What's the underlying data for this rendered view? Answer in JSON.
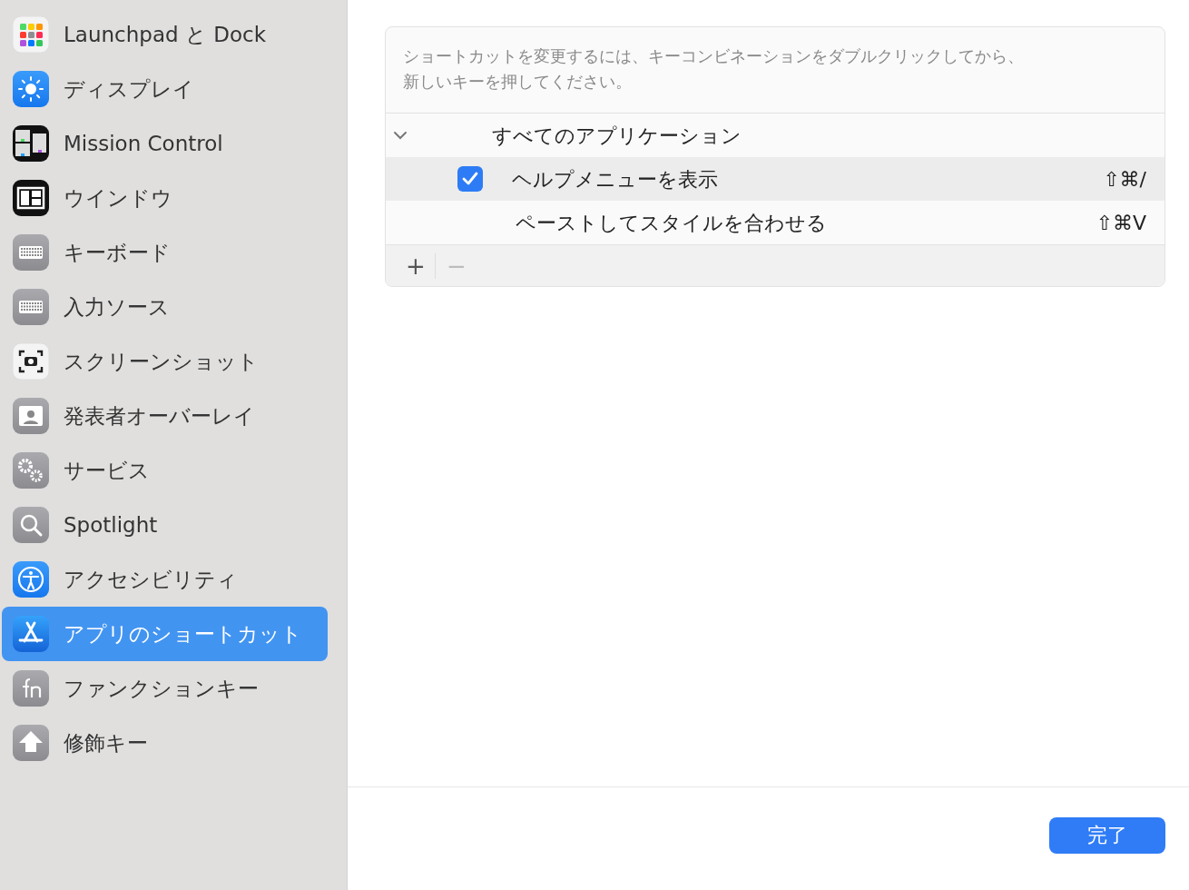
{
  "sidebar": {
    "items": [
      {
        "label": "Launchpad と Dock",
        "selected": false
      },
      {
        "label": "ディスプレイ",
        "selected": false
      },
      {
        "label": "Mission Control",
        "selected": false
      },
      {
        "label": "ウインドウ",
        "selected": false
      },
      {
        "label": "キーボード",
        "selected": false
      },
      {
        "label": "入力ソース",
        "selected": false
      },
      {
        "label": "スクリーンショット",
        "selected": false
      },
      {
        "label": "発表者オーバーレイ",
        "selected": false
      },
      {
        "label": "サービス",
        "selected": false
      },
      {
        "label": "Spotlight",
        "selected": false
      },
      {
        "label": "アクセシビリティ",
        "selected": false
      },
      {
        "label": "アプリのショートカット",
        "selected": true
      },
      {
        "label": "ファンクションキー",
        "selected": false
      },
      {
        "label": "修飾キー",
        "selected": false
      }
    ]
  },
  "shortcuts": {
    "hint_lines": [
      "ショートカットを変更するには、キーコンビネーションをダブルクリックしてから、",
      "新しいキーを押してください。"
    ],
    "group": {
      "label": "すべてのアプリケーション",
      "expanded": true,
      "rows": [
        {
          "kind": "checkbox",
          "checked": true,
          "label": "ヘルプメニューを表示",
          "keys": "⇧⌘/",
          "selected": true
        },
        {
          "kind": "plain",
          "label": "ペーストしてスタイルを合わせる",
          "keys": "⇧⌘V",
          "selected": false
        }
      ]
    },
    "add_button": {
      "label": "+",
      "disabled": false
    },
    "remove_button": {
      "label": "−",
      "disabled": true
    }
  },
  "done_button": {
    "label": "完了"
  }
}
